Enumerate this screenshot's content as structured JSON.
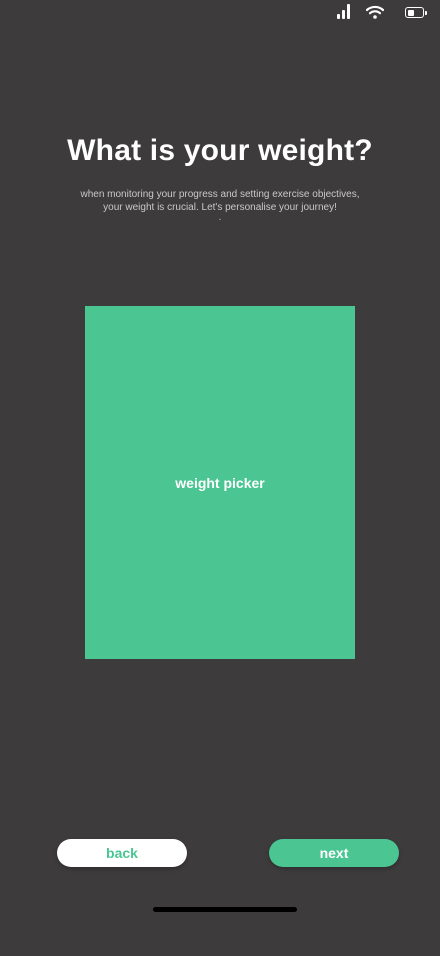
{
  "status_bar": {
    "icons": [
      "signal-icon",
      "wifi-icon",
      "battery-icon"
    ],
    "battery_level": 0.45
  },
  "header": {
    "title": "What is your weight?",
    "subtitle_line1": "when monitoring your progress and setting exercise objectives,",
    "subtitle_line2": "your weight is crucial. Let's personalise your journey!",
    "subtitle_dot": "."
  },
  "picker": {
    "label": "weight picker",
    "color": "#4bc592"
  },
  "footer": {
    "back_label": "back",
    "next_label": "next"
  },
  "colors": {
    "background": "#3d3b3c",
    "accent": "#4bc592"
  }
}
